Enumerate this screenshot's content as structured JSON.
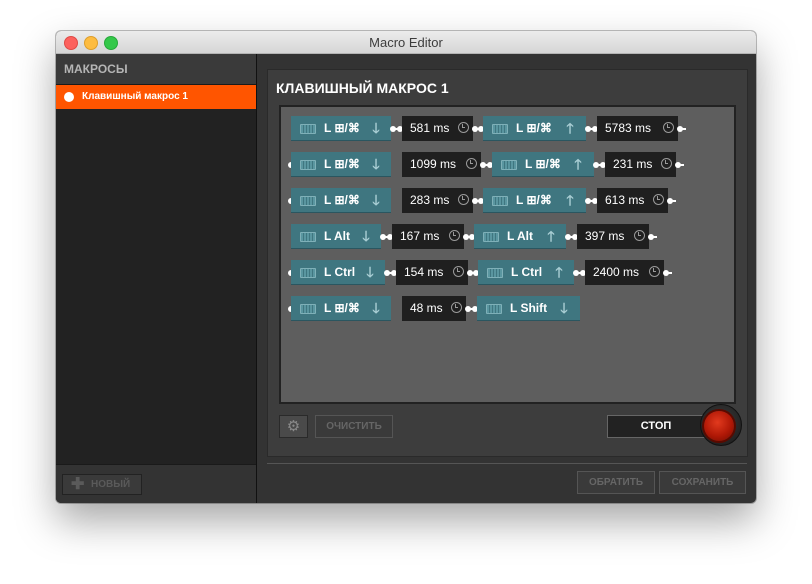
{
  "window": {
    "title": "Macro Editor"
  },
  "sidebar": {
    "header": "МАКРОСЫ",
    "items": [
      {
        "label": "Клавишный макрос 1",
        "selected": true
      }
    ],
    "new_button": "НОВЫЙ"
  },
  "macro": {
    "title": "КЛАВИШНЫЙ МАКРОС 1",
    "rows": [
      {
        "key1": "L ⊞/⌘",
        "arrow1": "down",
        "delay1": "581 ms",
        "key2": "L ⊞/⌘",
        "arrow2": "up",
        "delay2": "5783 ms"
      },
      {
        "key1": "L ⊞/⌘",
        "arrow1": "down",
        "delay1": "1099 ms",
        "key2": "L ⊞/⌘",
        "arrow2": "up",
        "delay2": "231 ms"
      },
      {
        "key1": "L ⊞/⌘",
        "arrow1": "down",
        "delay1": "283 ms",
        "key2": "L ⊞/⌘",
        "arrow2": "up",
        "delay2": "613 ms"
      },
      {
        "key1": "L Alt",
        "arrow1": "down",
        "delay1": "167 ms",
        "key2": "L Alt",
        "arrow2": "up",
        "delay2": "397 ms"
      },
      {
        "key1": "L Ctrl",
        "arrow1": "down",
        "delay1": "154 ms",
        "key2": "L Ctrl",
        "arrow2": "up",
        "delay2": "2400 ms"
      },
      {
        "key1": "L ⊞/⌘",
        "arrow1": "down",
        "delay1": "48 ms",
        "key2": "L Shift",
        "arrow2": "down",
        "delay2": ""
      }
    ]
  },
  "controls": {
    "clear_button": "ОЧИСТИТЬ",
    "stop_button": "СТОП",
    "revert_button": "ОБРАТИТЬ",
    "save_button": "СОХРАНИТЬ"
  },
  "icons": {
    "down_arrow": "🡓",
    "up_arrow": "🡑",
    "gear": "⚙",
    "plus": "✚"
  },
  "colors": {
    "accent": "#ff5500",
    "key_block": "#3f7680",
    "delay_block": "#1f1f1f",
    "record": "#b01806"
  }
}
